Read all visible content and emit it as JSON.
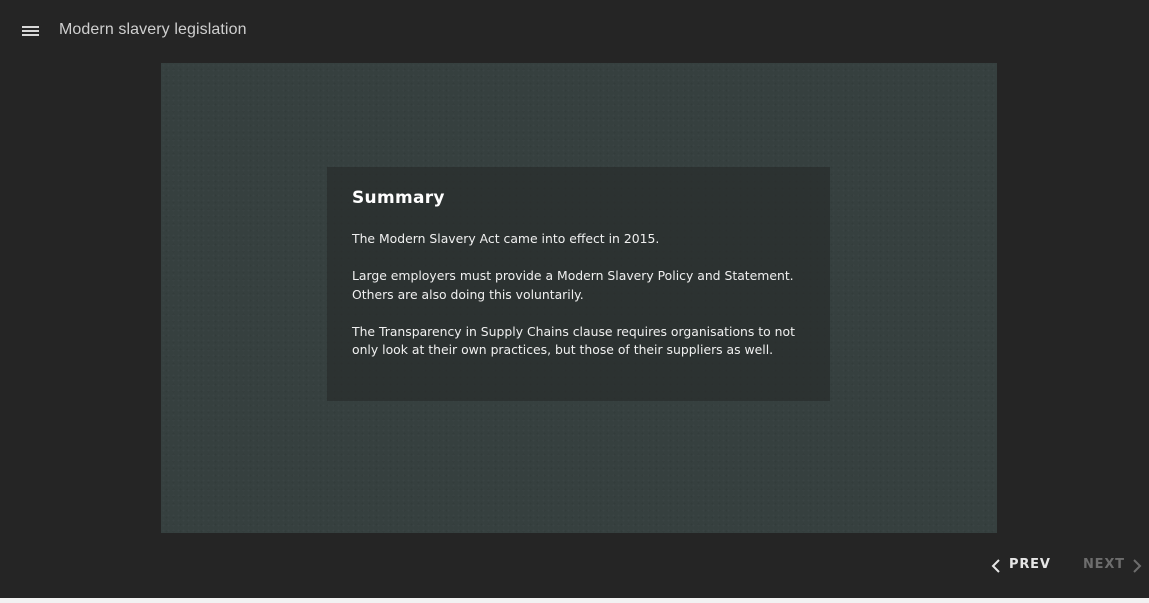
{
  "header": {
    "menu_icon": "hamburger-menu-icon",
    "title": "Modern slavery legislation"
  },
  "slide": {
    "heading": "Summary",
    "paragraphs": [
      "The Modern Slavery Act came into effect in 2015.",
      "Large employers must provide a Modern Slavery Policy and Statement. Others are also doing this voluntarily.",
      "The Transparency in Supply Chains clause requires organisations to not only look at their own practices, but those of their suppliers as well."
    ]
  },
  "navigation": {
    "prev_label": "PREV",
    "prev_icon": "chevron-left-icon",
    "next_label": "NEXT",
    "next_icon": "chevron-right-icon"
  },
  "colors": {
    "background": "#252525",
    "slide_background": "#36403f",
    "card_background": "#2c3030",
    "nav_active": "#e6e6e6",
    "nav_disabled": "#6d6d6d"
  }
}
